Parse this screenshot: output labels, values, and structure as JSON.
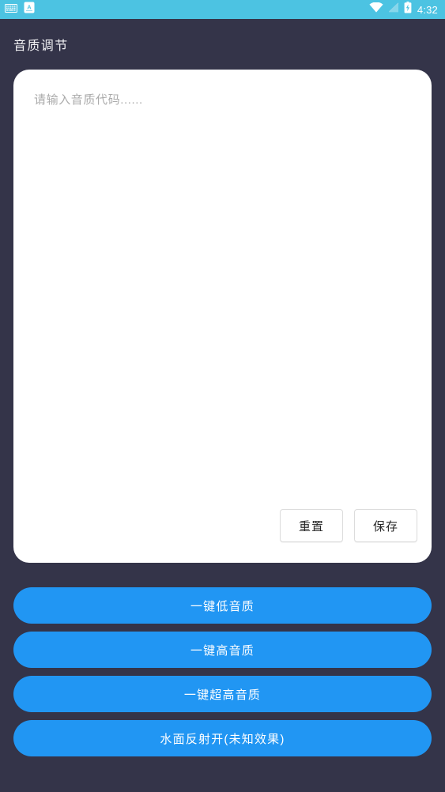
{
  "status_bar": {
    "icons_left": [
      {
        "name": "keyboard-icon",
        "label": "keyboard"
      },
      {
        "name": "input-method-icon",
        "label": "A"
      }
    ],
    "icons_right": [
      {
        "name": "wifi-icon",
        "label": "wifi"
      },
      {
        "name": "signal-off-icon",
        "label": "no-signal"
      },
      {
        "name": "battery-charging-icon",
        "label": "battery-charging"
      }
    ],
    "time": "4:32",
    "background_color": "#4CC3E2",
    "foreground_color": "#FFFFFF"
  },
  "header": {
    "title": "音质调节"
  },
  "editor": {
    "placeholder": "请输入音质代码......",
    "value": "",
    "reset_label": "重置",
    "save_label": "保存"
  },
  "actions": {
    "buttons": [
      {
        "label": "一键低音质"
      },
      {
        "label": "一键高音质"
      },
      {
        "label": "一键超高音质"
      },
      {
        "label": "水面反射开(未知效果)"
      }
    ]
  },
  "theme": {
    "background": "#343449",
    "card_background": "#FFFFFF",
    "accent_blue": "#2196F3",
    "status_cyan": "#4CC3E2",
    "placeholder_gray": "#ABABAB"
  }
}
